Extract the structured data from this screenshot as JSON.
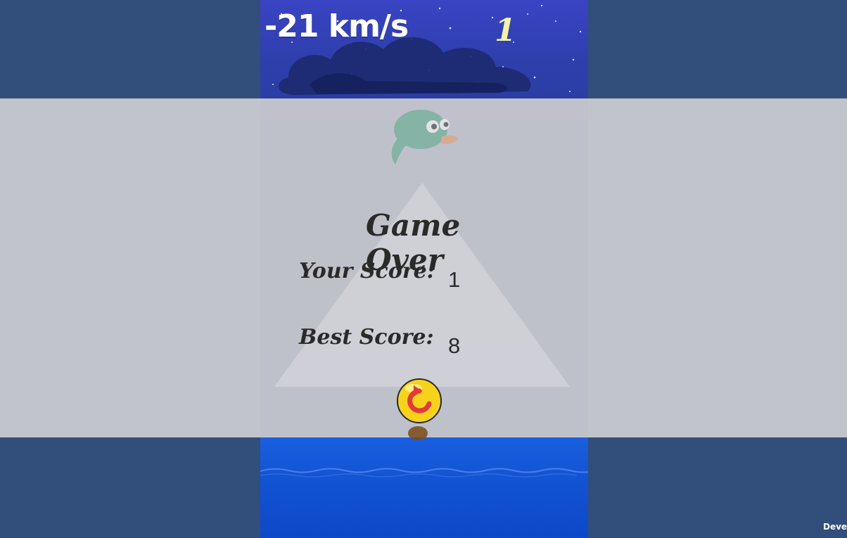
{
  "hud": {
    "speed": "-21 km/s",
    "score": "1"
  },
  "game_over": {
    "title": "Game Over",
    "your_score_label": "Your Score:",
    "your_score_value": "1",
    "best_score_label": "Best Score:",
    "best_score_value": "8",
    "restart_icon": "restart-icon"
  },
  "dev_badge": "Devel",
  "colors": {
    "page_background": "#324e7a",
    "overlay": "#cdcdd2",
    "sky_top": "#3a44c4",
    "ocean": "#1456d6",
    "speed_text": "#ffffff",
    "score_text": "#f3f4a8",
    "restart_button": "#f7d21b",
    "restart_arrow": "#e23a3a"
  }
}
